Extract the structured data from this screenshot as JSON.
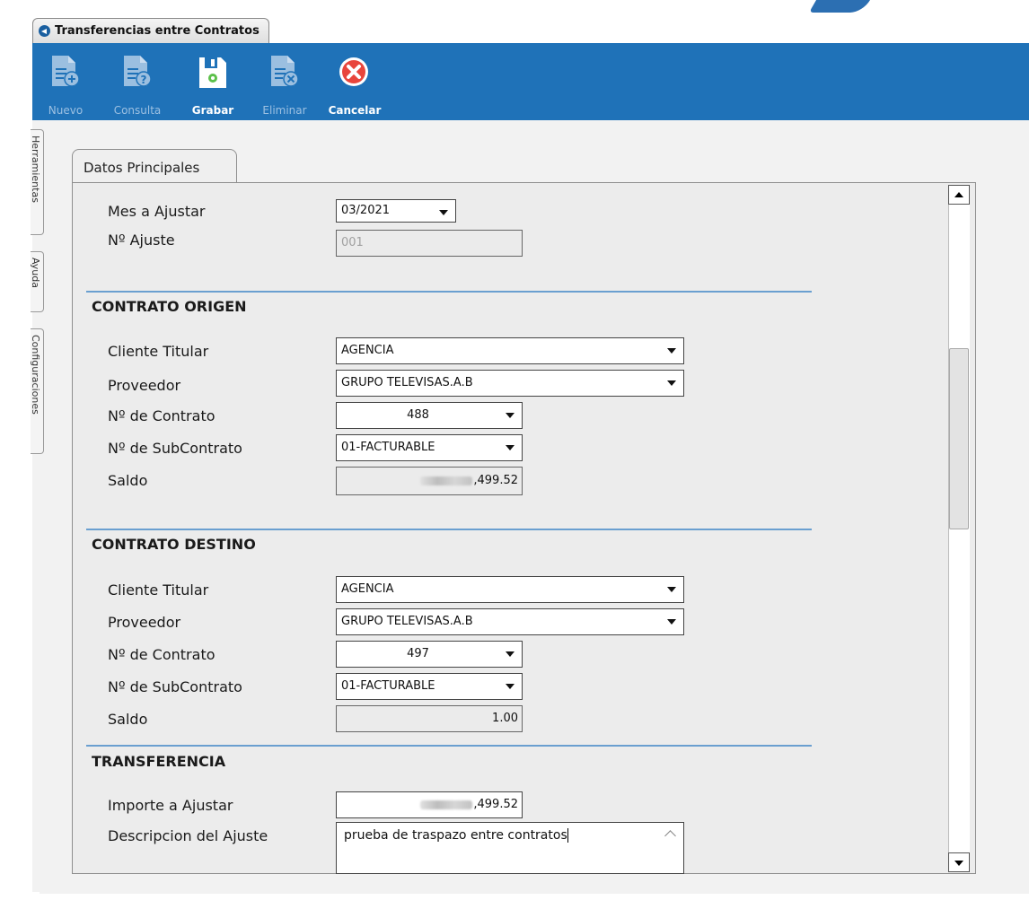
{
  "window": {
    "tab_title": "Transferencias entre Contratos"
  },
  "toolbar": {
    "nuevo": "Nuevo",
    "consulta": "Consulta",
    "grabar": "Grabar",
    "eliminar": "Eliminar",
    "cancelar": "Cancelar"
  },
  "side_tabs": [
    "Herramientas",
    "Ayuda",
    "Configuraciones"
  ],
  "form": {
    "tab": "Datos Principales",
    "mes_label": "Mes a Ajustar",
    "mes_value": "03/2021",
    "ajuste_label": "Nº Ajuste",
    "ajuste_value": "001",
    "origen": {
      "title": "CONTRATO ORIGEN",
      "cliente_label": "Cliente Titular",
      "cliente_value": "AGENCIA",
      "proveedor_label": "Proveedor",
      "proveedor_value": "GRUPO TELEVISAS.A.B",
      "contrato_label": "Nº de Contrato",
      "contrato_value": "488",
      "subcontrato_label": "Nº de SubContrato",
      "subcontrato_value": "01-FACTURABLE",
      "saldo_label": "Saldo",
      "saldo_value": ",499.52"
    },
    "destino": {
      "title": "CONTRATO DESTINO",
      "cliente_label": "Cliente Titular",
      "cliente_value": "AGENCIA",
      "proveedor_label": "Proveedor",
      "proveedor_value": "GRUPO TELEVISAS.A.B",
      "contrato_label": "Nº de Contrato",
      "contrato_value": "497",
      "subcontrato_label": "Nº de SubContrato",
      "subcontrato_value": "01-FACTURABLE",
      "saldo_label": "Saldo",
      "saldo_value": "1.00"
    },
    "transferencia": {
      "title": "TRANSFERENCIA",
      "importe_label": "Importe a Ajustar",
      "importe_value": ",499.52",
      "descripcion_label": "Descripcion del Ajuste",
      "descripcion_value": "prueba de traspazo entre contratos"
    }
  },
  "colors": {
    "toolbar": "#1f72b8",
    "section_rule": "#6a9fd0",
    "cancel": "#e8453c"
  }
}
